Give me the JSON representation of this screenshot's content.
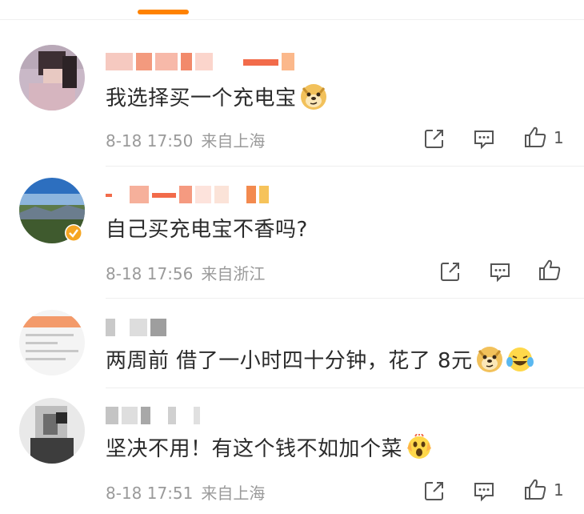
{
  "comments": [
    {
      "text": "我选择买一个充电宝",
      "emoji": [
        "doge-emoji"
      ],
      "date": "8-18 17:50",
      "location": "来自上海",
      "likes": "1"
    },
    {
      "text": "自己买充电宝不香吗?",
      "emoji": [],
      "date": "8-18 17:56",
      "location": "来自浙江",
      "likes": ""
    },
    {
      "text": "两周前 借了一小时四十分钟，花了 8元",
      "emoji": [
        "doge-emoji",
        "laughing-tears-emoji"
      ],
      "date": "",
      "location": "",
      "likes": ""
    },
    {
      "text": "坚决不用！有这个钱不如加个菜",
      "emoji": [
        "screaming-face-emoji"
      ],
      "date": "8-18 17:51",
      "location": "来自上海",
      "likes": "1"
    }
  ],
  "colors": {
    "accent": "#ff8200",
    "meta": "#9a9a9a",
    "verified": "#f5a623"
  }
}
